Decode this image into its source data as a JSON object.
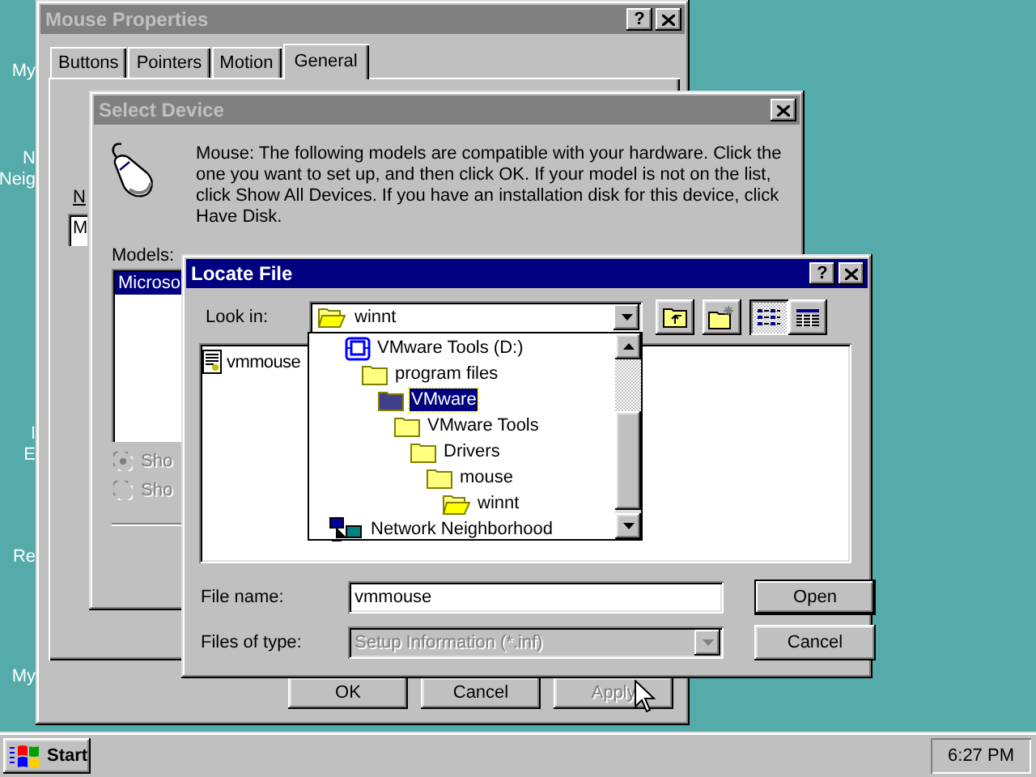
{
  "desktop": {
    "icon_labels": [
      {
        "lines": [
          "My"
        ]
      },
      {
        "lines": [
          "N",
          "Neig"
        ]
      },
      {
        "lines": [
          "I",
          "E"
        ]
      },
      {
        "lines": [
          "Re"
        ]
      },
      {
        "lines": [
          "My"
        ]
      }
    ]
  },
  "mouse_properties": {
    "title": "Mouse Properties",
    "active": false,
    "help": "?",
    "tabs": [
      {
        "label": "Buttons",
        "selected": false
      },
      {
        "label": "Pointers",
        "selected": false
      },
      {
        "label": "Motion",
        "selected": false
      },
      {
        "label": "General",
        "selected": true
      }
    ],
    "panel": {
      "label": "N",
      "field_value": "M"
    },
    "buttons": [
      {
        "label": "OK",
        "disabled": false
      },
      {
        "label": "Cancel",
        "disabled": false
      },
      {
        "label": "Apply",
        "disabled": true
      }
    ]
  },
  "select_device": {
    "title": "Select Device",
    "active": false,
    "message": "Mouse: The following models are compatible with your hardware. Click the one you want to set up, and then click OK. If your model is not on the list, click Show All Devices. If you have an installation disk for this device, click Have Disk.",
    "models_label": "Models:",
    "models": [
      {
        "label": "Microso",
        "selected": true
      }
    ],
    "options": [
      {
        "label": "Sho",
        "selected": true,
        "disabled": true
      },
      {
        "label": "Sho",
        "selected": false,
        "disabled": true
      }
    ]
  },
  "locate_file": {
    "title": "Locate File",
    "active": true,
    "help": "?",
    "look_in": {
      "label": "Look in:",
      "value": "winnt",
      "expanded": true
    },
    "toolbar": [
      {
        "kind": "up",
        "selected": false
      },
      {
        "kind": "new_folder",
        "selected": false
      },
      {
        "kind": "list",
        "selected": true
      },
      {
        "kind": "details",
        "selected": false
      }
    ],
    "dropdown": [
      {
        "label": "VMware Tools (D:)",
        "kind": "drive",
        "selected": false,
        "children": [
          {
            "label": "program files",
            "kind": "folder",
            "selected": false,
            "children": [
              {
                "label": "VMware",
                "kind": "folder",
                "selected": true,
                "children": [
                  {
                    "label": "VMware Tools",
                    "kind": "folder",
                    "selected": false,
                    "children": [
                      {
                        "label": "Drivers",
                        "kind": "folder",
                        "selected": false,
                        "children": [
                          {
                            "label": "mouse",
                            "kind": "folder",
                            "selected": false,
                            "children": [
                              {
                                "label": "winnt",
                                "kind": "open_folder",
                                "selected": false
                              }
                            ]
                          }
                        ]
                      }
                    ]
                  }
                ]
              }
            ]
          }
        ]
      },
      {
        "label": "Network Neighborhood",
        "kind": "network",
        "selected": false
      }
    ],
    "files": [
      {
        "name": "vmmouse"
      }
    ],
    "file_name": {
      "label": "File name:",
      "value": "vmmouse"
    },
    "file_type": {
      "label": "Files of type:",
      "value": "Setup Information (*.inf)",
      "disabled": true
    },
    "buttons": [
      {
        "label": "Open",
        "default": true
      },
      {
        "label": "Cancel",
        "default": false
      }
    ]
  },
  "taskbar": {
    "start": "Start",
    "clock": "6:27 PM"
  }
}
